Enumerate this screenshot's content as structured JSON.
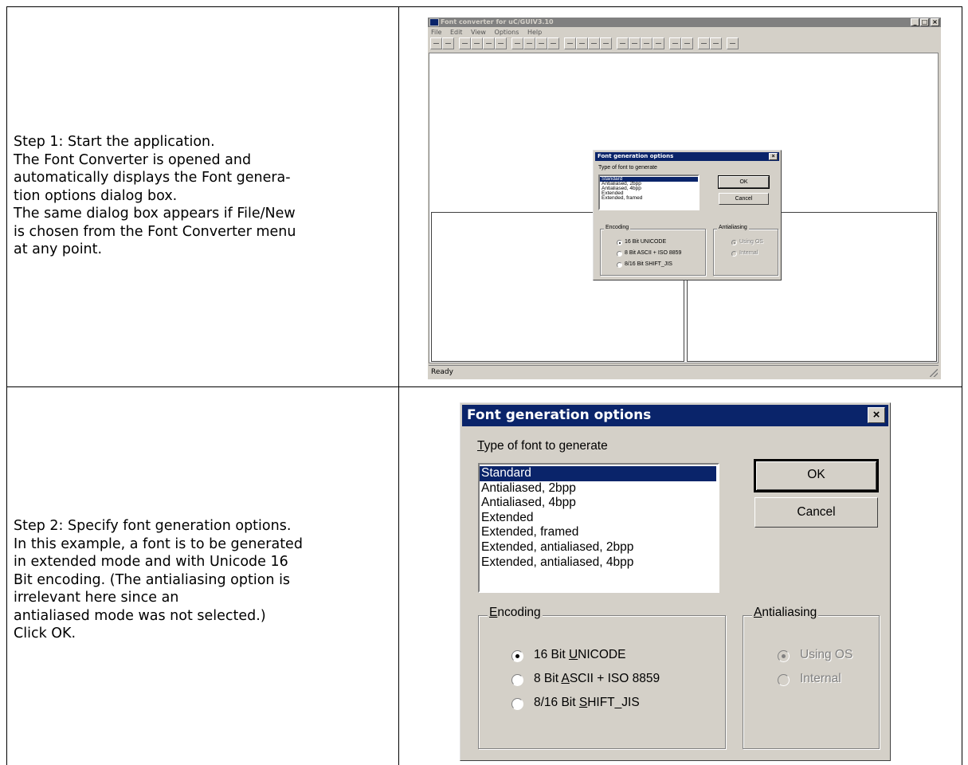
{
  "step1": {
    "lines": [
      "Step 1: Start the application.",
      "The Font Converter is opened and",
      "automatically displays the Font genera-",
      "tion options dialog box.",
      "The same dialog box appears if File/New",
      "is chosen from the Font Converter menu",
      "at any point."
    ]
  },
  "step2": {
    "lines": [
      "Step 2: Specify font generation options.",
      "In this example, a font is to be generated",
      "in extended mode and with Unicode 16",
      "Bit encoding. (The antialiasing option is",
      "irrelevant here since an",
      "antialiased mode was not selected.)",
      "Click OK."
    ]
  },
  "app": {
    "title": "Font converter for uC/GUIV3.10",
    "menu": [
      "File",
      "Edit",
      "View",
      "Options",
      "Help"
    ],
    "window_buttons": [
      "_",
      "□",
      "×"
    ],
    "status": "Ready"
  },
  "dialog_small": {
    "title": "Font generation options",
    "close": "×",
    "type_label": "Type of font to generate",
    "font_types": [
      "Standard",
      "Antialiased, 2bpp",
      "Antialiased, 4bpp",
      "Extended",
      "Extended, framed"
    ],
    "ok": "OK",
    "cancel": "Cancel",
    "encoding_label": "Encoding",
    "encodings": [
      "16 Bit UNICODE",
      "8 Bit ASCII + ISO 8859",
      "8/16 Bit SHIFT_JIS"
    ],
    "antialiasing_label": "Antialiasing",
    "antialiasing": [
      "Using OS",
      "Internal"
    ]
  },
  "dialog": {
    "title": "Font generation options",
    "close": "×",
    "type_label_u": "T",
    "type_label_rest": "ype of font to generate",
    "font_types": [
      "Standard",
      "Antialiased, 2bpp",
      "Antialiased, 4bpp",
      "Extended",
      "Extended, framed",
      "Extended, antialiased, 2bpp",
      "Extended, antialiased, 4bpp"
    ],
    "selected_font_type": "Standard",
    "ok": "OK",
    "cancel": "Cancel",
    "encoding_label_u": "E",
    "encoding_label_rest": "ncoding",
    "enc1_a": "16 Bit ",
    "enc1_u": "U",
    "enc1_b": "NICODE",
    "enc2_a": "8 Bit ",
    "enc2_u": "A",
    "enc2_b": "SCII + ISO 8859",
    "enc3_a": "8/16 Bit ",
    "enc3_u": "S",
    "enc3_b": "HIFT_JIS",
    "selected_encoding": "16 Bit UNICODE",
    "antialiasing_label_u": "A",
    "antialiasing_label_rest": "ntialiasing",
    "aa_options": [
      "Using OS",
      "Internal"
    ],
    "selected_antialiasing": "Using OS"
  }
}
